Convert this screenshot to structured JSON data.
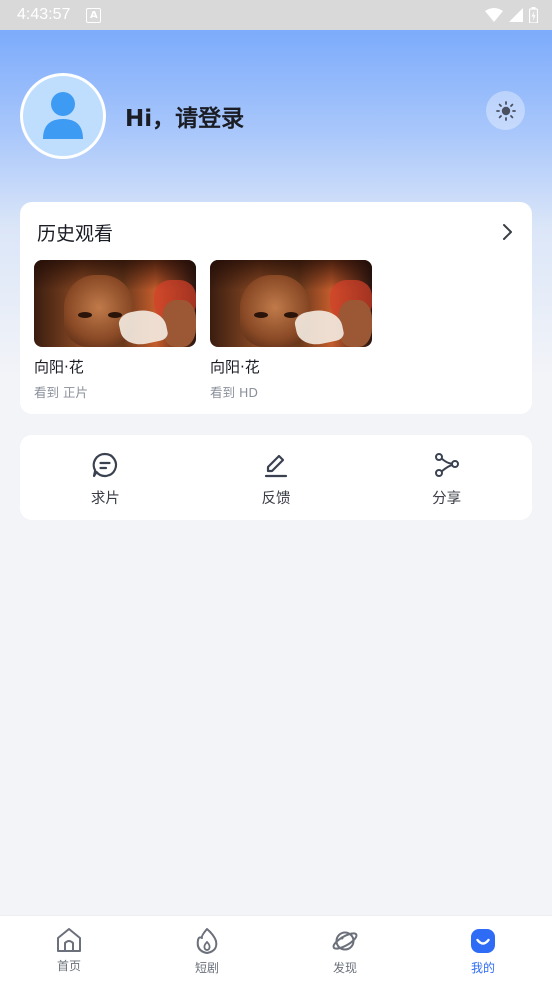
{
  "status_bar": {
    "time": "4:43:57",
    "a_icon": "A"
  },
  "profile": {
    "greeting": "Hi，请登录"
  },
  "history": {
    "title": "历史观看",
    "items": [
      {
        "title": "向阳·花",
        "progress": "看到 正片"
      },
      {
        "title": "向阳·花",
        "progress": "看到 HD"
      }
    ]
  },
  "actions": [
    {
      "label": "求片",
      "icon": "chat-icon"
    },
    {
      "label": "反馈",
      "icon": "edit-icon"
    },
    {
      "label": "分享",
      "icon": "share-icon"
    }
  ],
  "tabs": [
    {
      "label": "首页",
      "icon": "home-icon"
    },
    {
      "label": "短剧",
      "icon": "flame-icon"
    },
    {
      "label": "发现",
      "icon": "planet-icon"
    },
    {
      "label": "我的",
      "icon": "smile-icon",
      "active": true
    }
  ],
  "colors": {
    "accent": "#2f6cf6",
    "avatar_bg": "#bfdefd",
    "avatar_figure": "#3e9bf3"
  }
}
